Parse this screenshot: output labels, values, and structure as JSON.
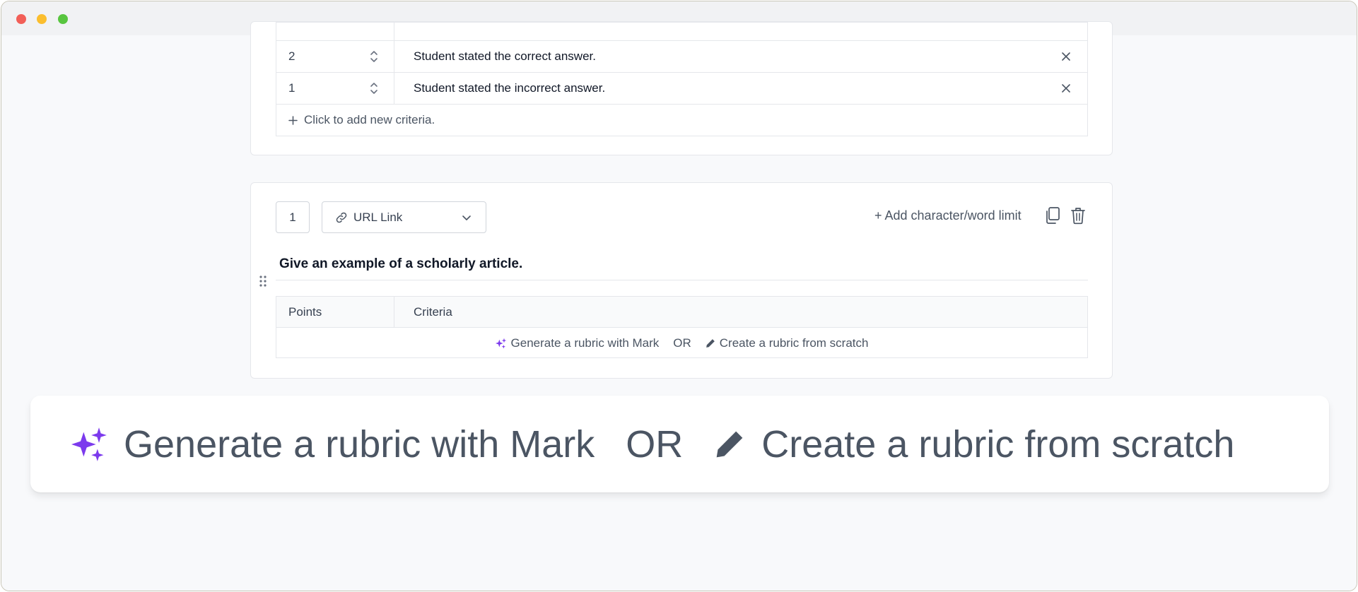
{
  "window": {
    "controls": [
      "close",
      "minimize",
      "maximize"
    ]
  },
  "question1": {
    "criteria": [
      {
        "points": "2",
        "text": "Student stated the correct  answer."
      },
      {
        "points": "1",
        "text": "Student stated the incorrect answer."
      }
    ],
    "add_criteria_label": "Click to add new criteria."
  },
  "question2": {
    "number": "1",
    "type_label": "URL Link",
    "add_limit_label": "+ Add character/word limit",
    "prompt": "Give an example of a scholarly article.",
    "table": {
      "col_points": "Points",
      "col_criteria": "Criteria"
    },
    "generate_label": "Generate a rubric with Mark",
    "or_label": "OR",
    "scratch_label": "Create a rubric from scratch"
  },
  "banner": {
    "generate_label": "Generate a rubric with Mark",
    "or_label": "OR",
    "scratch_label": "Create a rubric from scratch"
  },
  "colors": {
    "accent_purple": "#7c3aed",
    "text_gray": "#4b5563",
    "border": "#e5e7eb"
  }
}
